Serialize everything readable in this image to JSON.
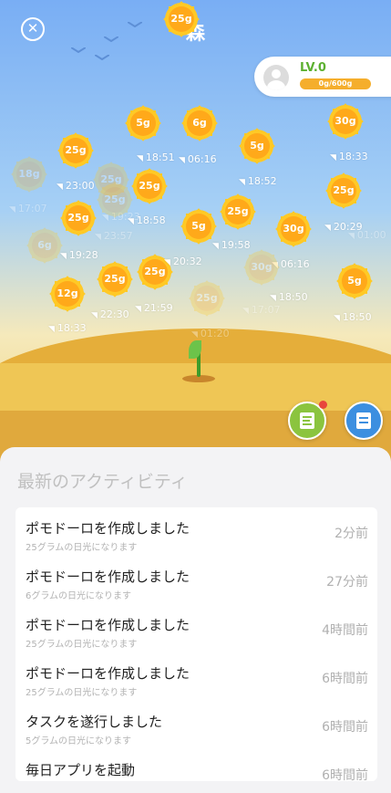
{
  "header": {
    "title": "森"
  },
  "level": {
    "label": "LV.0",
    "progress_text": "0g/600g",
    "progress": 0
  },
  "suns": [
    {
      "value": "5g",
      "time": "18:51",
      "faded": false
    },
    {
      "value": "6g",
      "time": "06:16",
      "faded": false
    },
    {
      "value": "5g",
      "time": "18:52",
      "faded": false
    },
    {
      "value": "30g",
      "time": "18:33",
      "faded": false
    },
    {
      "value": "25g",
      "time": "23:00",
      "faded": false
    },
    {
      "value": "25g",
      "time": "18:58",
      "faded": false
    },
    {
      "value": "25g",
      "time": "20:29",
      "faded": false
    },
    {
      "value": "25g",
      "time": "19:28",
      "faded": false
    },
    {
      "value": "5g",
      "time": "19:58",
      "faded": false
    },
    {
      "value": "25g",
      "time": "",
      "faded": false
    },
    {
      "value": "30g",
      "time": "06:16",
      "faded": false
    },
    {
      "value": "25g",
      "time": "22:30",
      "faded": false
    },
    {
      "value": "25g",
      "time": "21:59",
      "faded": false
    },
    {
      "value": "12g",
      "time": "18:33",
      "faded": false
    },
    {
      "value": "25g",
      "time": "20:32",
      "faded": false
    },
    {
      "value": "5g",
      "time": "18:50",
      "faded": false
    },
    {
      "value": "",
      "time": "18:50",
      "faded": false
    },
    {
      "value": "18g",
      "time": "17:07",
      "faded": true
    },
    {
      "value": "25g",
      "time": "19:23",
      "faded": true
    },
    {
      "value": "25g",
      "time": "23:57",
      "faded": true
    },
    {
      "value": "6g",
      "time": "",
      "faded": true
    },
    {
      "value": "",
      "time": "01:00",
      "faded": true
    },
    {
      "value": "30g",
      "time": "17:07",
      "faded": true
    },
    {
      "value": "25g",
      "time": "01:20",
      "faded": true
    }
  ],
  "actions": {
    "tasks_icon": "checklist-icon",
    "book_icon": "book-icon"
  },
  "panel": {
    "heading": "最新のアクティビティ"
  },
  "activities": [
    {
      "title": "ポモドーロを作成しました",
      "sub": "25グラムの日光になります",
      "time": "2分前"
    },
    {
      "title": "ポモドーロを作成しました",
      "sub": "6グラムの日光になります",
      "time": "27分前"
    },
    {
      "title": "ポモドーロを作成しました",
      "sub": "25グラムの日光になります",
      "time": "4時間前"
    },
    {
      "title": "ポモドーロを作成しました",
      "sub": "25グラムの日光になります",
      "time": "6時間前"
    },
    {
      "title": "タスクを遂行しました",
      "sub": "5グラムの日光になります",
      "time": "6時間前"
    },
    {
      "title": "毎日アプリを起動",
      "sub": "",
      "time": "6時間前"
    }
  ]
}
